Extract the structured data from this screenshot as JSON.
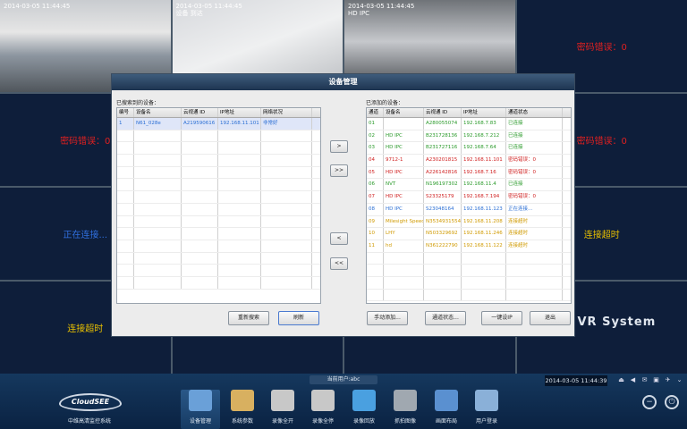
{
  "grid": {
    "cells": [
      {
        "kind": "camera",
        "ts": "2014-03-05 11:44:45",
        "label": "",
        "style": "cam1"
      },
      {
        "kind": "camera",
        "ts": "2014-03-05 11:44:45\n设备 到达",
        "label": "",
        "style": "cam2"
      },
      {
        "kind": "camera",
        "ts": "2014-03-05 11:44:45\nHD IPC",
        "label": "",
        "style": "cam3"
      },
      {
        "kind": "status",
        "text": "密码错误：0",
        "color": "red"
      },
      {
        "kind": "status",
        "text": "密码错误：0",
        "color": "red"
      },
      {
        "kind": "blank",
        "text": ""
      },
      {
        "kind": "blank",
        "text": ""
      },
      {
        "kind": "status",
        "text": "密码错误：0",
        "color": "red"
      },
      {
        "kind": "status",
        "text": "正在连接...",
        "color": "blue"
      },
      {
        "kind": "blank",
        "text": ""
      },
      {
        "kind": "blank",
        "text": ""
      },
      {
        "kind": "status",
        "text": "连接超时",
        "color": "yellow"
      },
      {
        "kind": "status",
        "text": "连接超时",
        "color": "yellow"
      },
      {
        "kind": "blank",
        "text": ""
      },
      {
        "kind": "blank",
        "text": ""
      },
      {
        "kind": "logo",
        "text": "VR System"
      }
    ]
  },
  "dialog": {
    "title": "设备管理",
    "searched_label": "已搜索到的设备：",
    "added_label": "已添加的设备：",
    "searched_columns": [
      "编号",
      "设备名",
      "云视通 ID",
      "IP地址",
      "网络状况"
    ],
    "searched_rows": [
      [
        "1",
        "N61_028e",
        "A219590616",
        "192.168.11.101",
        "非常好"
      ]
    ],
    "added_columns": [
      "通道",
      "设备名",
      "云视通 ID",
      "IP地址",
      "通道状态"
    ],
    "added_rows": [
      {
        "c": "g",
        "v": [
          "01",
          "",
          "A280055074",
          "192.168.7.83",
          "已连接"
        ]
      },
      {
        "c": "g",
        "v": [
          "02",
          "HD IPC",
          "B231728136",
          "192.168.7.212",
          "已连接"
        ]
      },
      {
        "c": "g",
        "v": [
          "03",
          "HD IPC",
          "B231727116",
          "192.168.7.64",
          "已连接"
        ]
      },
      {
        "c": "r",
        "v": [
          "04",
          "9712-1",
          "A230201815",
          "192.168.11.101",
          "密码错误：0"
        ]
      },
      {
        "c": "r",
        "v": [
          "05",
          "HD IPC",
          "A226142816",
          "192.168.7.16",
          "密码错误：0"
        ]
      },
      {
        "c": "g",
        "v": [
          "06",
          "NVT",
          "N196197302",
          "192.168.11.4",
          "已连接"
        ]
      },
      {
        "c": "r",
        "v": [
          "07",
          "HD IPC",
          "S23325179",
          "192.168.7.194",
          "密码错误：0"
        ]
      },
      {
        "c": "b",
        "v": [
          "08",
          "HD IPC",
          "S23048164",
          "192.168.11.123",
          "正在连接..."
        ]
      },
      {
        "c": "y",
        "v": [
          "09",
          "Milesight Speed",
          "N3534931554",
          "192.168.11.208",
          "连接超时"
        ]
      },
      {
        "c": "y",
        "v": [
          "10",
          "LHY",
          "N503329692",
          "192.168.11.246",
          "连接超时"
        ]
      },
      {
        "c": "y",
        "v": [
          "11",
          "hd",
          "N361222790",
          "192.168.11.122",
          "连接超时"
        ]
      }
    ],
    "arrows": {
      "add_one": ">",
      "add_all": ">>",
      "remove_one": "<",
      "remove_all": "<<"
    },
    "buttons": {
      "research": "重新搜索",
      "refresh": "刷新",
      "manual_add": "手动添加...",
      "channel_status": "通道状态...",
      "one_key_ip": "一键设IP",
      "exit": "退出"
    }
  },
  "taskbar": {
    "current_user": "当前用户:abc",
    "datetime": "2014-03-05 11:44:39",
    "logo_text": "CloudSEE",
    "system_name": "中维高清监控系统",
    "items": [
      {
        "label": "设备管理",
        "icon": "device-manage-icon",
        "color": "#6aa0d8"
      },
      {
        "label": "系统参数",
        "icon": "tools-icon",
        "color": "#d8b060"
      },
      {
        "label": "录像全开",
        "icon": "record-all-on-icon",
        "color": "#c8c8c8"
      },
      {
        "label": "录像全停",
        "icon": "record-all-stop-icon",
        "color": "#c8c8c8"
      },
      {
        "label": "录像回放",
        "icon": "playback-icon",
        "color": "#4aa0e0"
      },
      {
        "label": "抓拍图像",
        "icon": "snapshot-icon",
        "color": "#a0a8b0"
      },
      {
        "label": "画面布局",
        "icon": "layout-icon",
        "color": "#5a90d0"
      },
      {
        "label": "用户登录",
        "icon": "user-login-icon",
        "color": "#8ab0d8"
      }
    ]
  }
}
